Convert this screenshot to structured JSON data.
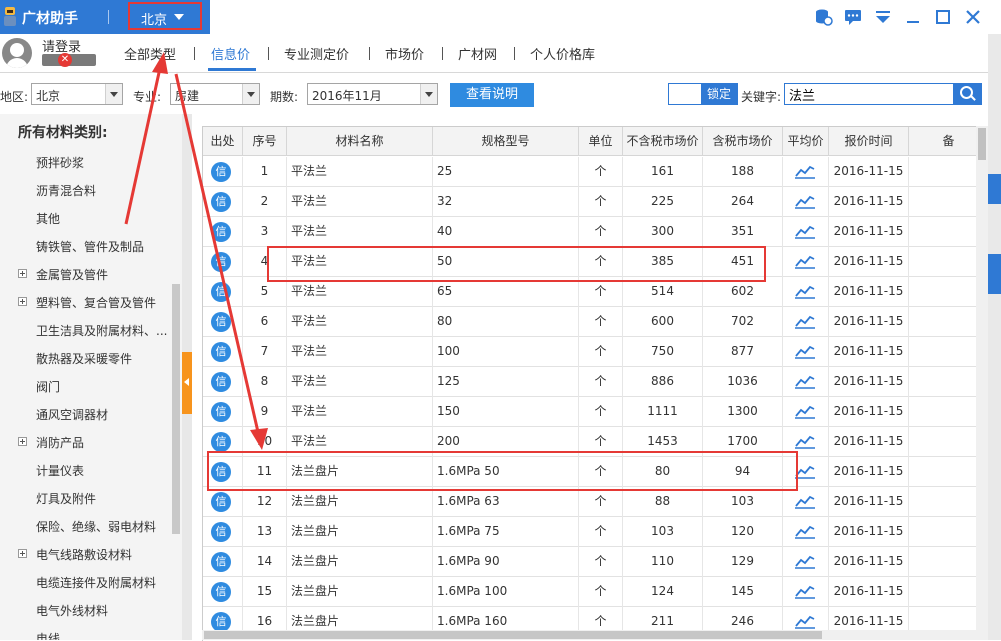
{
  "app": {
    "title": "广材助手",
    "city": "北京",
    "login_text": "请登录"
  },
  "nav": {
    "tabs": [
      "全部类型",
      "信息价",
      "专业测定价",
      "市场价",
      "广材网",
      "个人价格库"
    ],
    "active_index": 1
  },
  "filters": {
    "region_label": "地区:",
    "region_value": "北京",
    "specialty_label": "专业:",
    "specialty_value": "房建",
    "period_label": "期数:",
    "period_value": "2016年11月",
    "explain_button": "查看说明",
    "lock_label": "锁定",
    "keyword_label": "关键字:",
    "keyword_value": "法兰"
  },
  "sidebar": {
    "heading": "所有材料类别:",
    "items": [
      {
        "label": "预拌砂浆",
        "expandable": false
      },
      {
        "label": "沥青混合料",
        "expandable": false
      },
      {
        "label": "其他",
        "expandable": false
      },
      {
        "label": "铸铁管、管件及制品",
        "expandable": false
      },
      {
        "label": "金属管及管件",
        "expandable": true
      },
      {
        "label": "塑料管、复合管及管件",
        "expandable": true
      },
      {
        "label": "卫生洁具及附属材料、...",
        "expandable": false
      },
      {
        "label": "散热器及采暖零件",
        "expandable": false
      },
      {
        "label": "阀门",
        "expandable": false
      },
      {
        "label": "通风空调器材",
        "expandable": false
      },
      {
        "label": "消防产品",
        "expandable": true
      },
      {
        "label": "计量仪表",
        "expandable": false
      },
      {
        "label": "灯具及附件",
        "expandable": false
      },
      {
        "label": "保险、绝缘、弱电材料",
        "expandable": false
      },
      {
        "label": "电气线路敷设材料",
        "expandable": true
      },
      {
        "label": "电缆连接件及附属材料",
        "expandable": false
      },
      {
        "label": "电气外线材料",
        "expandable": false
      },
      {
        "label": "电线",
        "expandable": false
      }
    ]
  },
  "table": {
    "columns": [
      "出处",
      "序号",
      "材料名称",
      "规格型号",
      "单位",
      "不含税市场价",
      "含税市场价",
      "平均价",
      "报价时间",
      "备"
    ],
    "info_icon_text": "信",
    "rows": [
      {
        "no": "1",
        "name": "平法兰",
        "spec": "25",
        "unit": "个",
        "price_ex": "161",
        "price_inc": "188",
        "date": "2016-11-15"
      },
      {
        "no": "2",
        "name": "平法兰",
        "spec": "32",
        "unit": "个",
        "price_ex": "225",
        "price_inc": "264",
        "date": "2016-11-15"
      },
      {
        "no": "3",
        "name": "平法兰",
        "spec": "40",
        "unit": "个",
        "price_ex": "300",
        "price_inc": "351",
        "date": "2016-11-15"
      },
      {
        "no": "4",
        "name": "平法兰",
        "spec": "50",
        "unit": "个",
        "price_ex": "385",
        "price_inc": "451",
        "date": "2016-11-15"
      },
      {
        "no": "5",
        "name": "平法兰",
        "spec": "65",
        "unit": "个",
        "price_ex": "514",
        "price_inc": "602",
        "date": "2016-11-15"
      },
      {
        "no": "6",
        "name": "平法兰",
        "spec": "80",
        "unit": "个",
        "price_ex": "600",
        "price_inc": "702",
        "date": "2016-11-15"
      },
      {
        "no": "7",
        "name": "平法兰",
        "spec": "100",
        "unit": "个",
        "price_ex": "750",
        "price_inc": "877",
        "date": "2016-11-15"
      },
      {
        "no": "8",
        "name": "平法兰",
        "spec": "125",
        "unit": "个",
        "price_ex": "886",
        "price_inc": "1036",
        "date": "2016-11-15"
      },
      {
        "no": "9",
        "name": "平法兰",
        "spec": "150",
        "unit": "个",
        "price_ex": "1111",
        "price_inc": "1300",
        "date": "2016-11-15"
      },
      {
        "no": "10",
        "name": "平法兰",
        "spec": "200",
        "unit": "个",
        "price_ex": "1453",
        "price_inc": "1700",
        "date": "2016-11-15"
      },
      {
        "no": "11",
        "name": "法兰盘片",
        "spec": "1.6MPa 50",
        "unit": "个",
        "price_ex": "80",
        "price_inc": "94",
        "date": "2016-11-15"
      },
      {
        "no": "12",
        "name": "法兰盘片",
        "spec": "1.6MPa 63",
        "unit": "个",
        "price_ex": "88",
        "price_inc": "103",
        "date": "2016-11-15"
      },
      {
        "no": "13",
        "name": "法兰盘片",
        "spec": "1.6MPa 75",
        "unit": "个",
        "price_ex": "103",
        "price_inc": "120",
        "date": "2016-11-15"
      },
      {
        "no": "14",
        "name": "法兰盘片",
        "spec": "1.6MPa 90",
        "unit": "个",
        "price_ex": "110",
        "price_inc": "129",
        "date": "2016-11-15"
      },
      {
        "no": "15",
        "name": "法兰盘片",
        "spec": "1.6MPa 100",
        "unit": "个",
        "price_ex": "124",
        "price_inc": "145",
        "date": "2016-11-15"
      },
      {
        "no": "16",
        "name": "法兰盘片",
        "spec": "1.6MPa 160",
        "unit": "个",
        "price_ex": "211",
        "price_inc": "246",
        "date": "2016-11-15"
      }
    ]
  },
  "icons": {
    "window_controls": [
      "database-icon",
      "chat-icon",
      "dropdown-menu-icon",
      "minimize-icon",
      "maximize-icon",
      "close-icon"
    ],
    "trend": "line-chart-icon"
  },
  "colors": {
    "brand_blue": "#2f79d4",
    "annotation_red": "#e53935",
    "splitter_orange": "#f7941d"
  }
}
